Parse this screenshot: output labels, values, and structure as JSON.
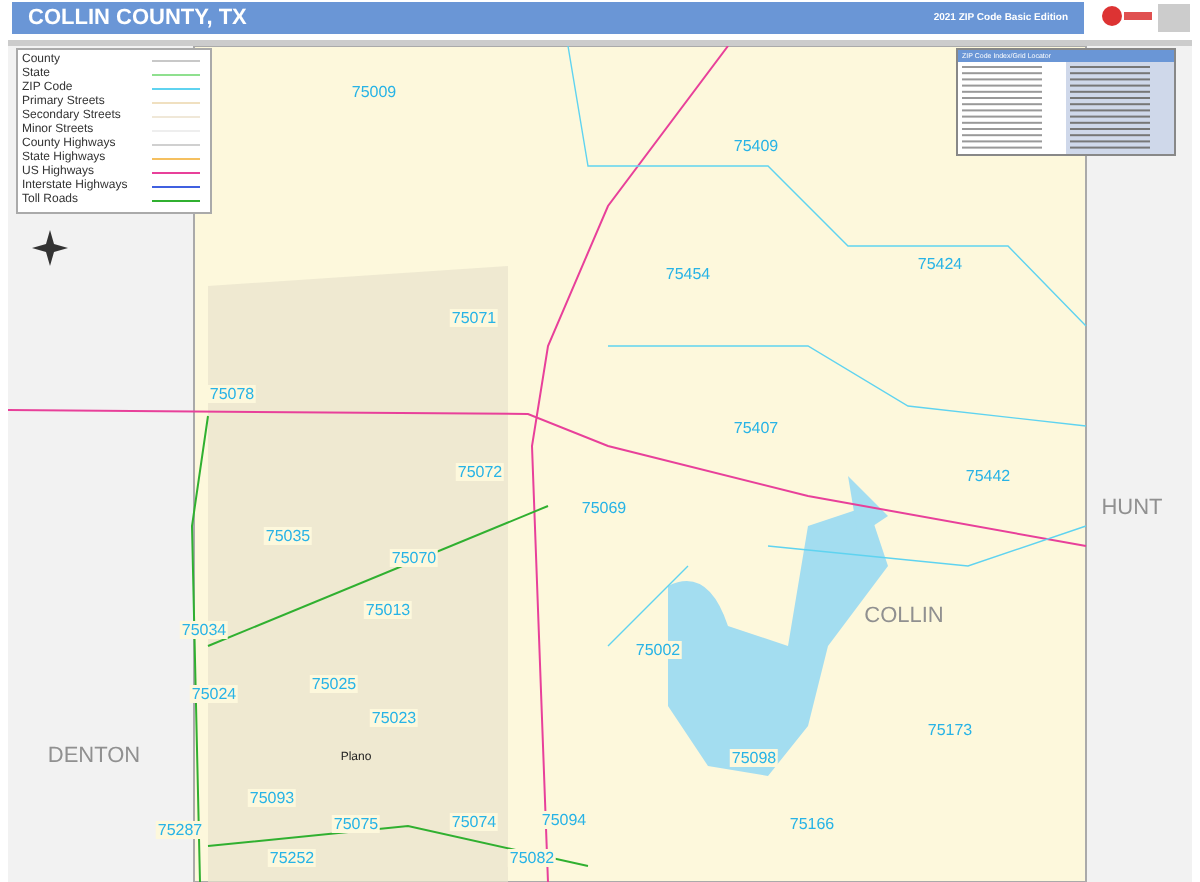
{
  "header": {
    "title": "COLLIN COUNTY, TX",
    "edition": "2021 ZIP Code Basic Edition"
  },
  "legend": {
    "items": [
      {
        "label": "County",
        "color": "#c8c8c8"
      },
      {
        "label": "State",
        "color": "#8fe08f"
      },
      {
        "label": "ZIP Code",
        "color": "#5fd3f0"
      },
      {
        "label": "Primary Streets",
        "color": "#f0e0c0"
      },
      {
        "label": "Secondary Streets",
        "color": "#f0e8d8"
      },
      {
        "label": "Minor Streets",
        "color": "#eeeeee"
      },
      {
        "label": "County Highways",
        "color": "#d0d0d0"
      },
      {
        "label": "State Highways",
        "color": "#f5c060"
      },
      {
        "label": "US Highways",
        "color": "#e8409a"
      },
      {
        "label": "Interstate Highways",
        "color": "#4060e0"
      },
      {
        "label": "Toll Roads",
        "color": "#30b030"
      }
    ]
  },
  "index": {
    "title": "ZIP Code Index/Grid Locator"
  },
  "map": {
    "zip_labels": [
      "75009",
      "75409",
      "75424",
      "75454",
      "75071",
      "75078",
      "75407",
      "75442",
      "75072",
      "75069",
      "75035",
      "75070",
      "75013",
      "75034",
      "75002",
      "75024",
      "75025",
      "75023",
      "75098",
      "75173",
      "75093",
      "75075",
      "75074",
      "75094",
      "75166",
      "75287",
      "75252",
      "75082"
    ],
    "county_labels": [
      "HUNT",
      "COLLIN",
      "DENTON"
    ],
    "city_labels": [
      "Plano"
    ]
  }
}
